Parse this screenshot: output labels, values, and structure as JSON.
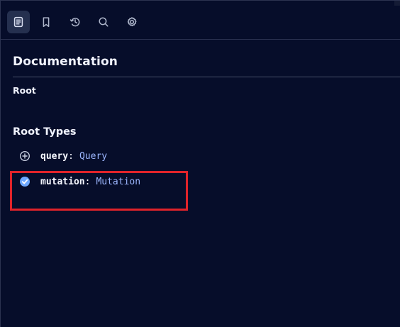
{
  "toolbar": {
    "buttons": [
      {
        "name": "docs",
        "icon": "document-icon",
        "active": true
      },
      {
        "name": "bookmark",
        "icon": "bookmark-icon",
        "active": false
      },
      {
        "name": "history",
        "icon": "history-icon",
        "active": false
      },
      {
        "name": "search",
        "icon": "search-icon",
        "active": false
      },
      {
        "name": "settings",
        "icon": "gear-icon",
        "active": false
      }
    ]
  },
  "doc": {
    "title": "Documentation",
    "breadcrumb": "Root",
    "section_title": "Root Types",
    "fields": [
      {
        "name": "query",
        "colon": ":",
        "type": "Query",
        "icon": "plus-circle-icon",
        "selected": false
      },
      {
        "name": "mutation",
        "colon": ":",
        "type": "Mutation",
        "icon": "check-circle-icon",
        "selected": true
      }
    ]
  },
  "annotation": {
    "highlight_color": "#e0232a"
  }
}
